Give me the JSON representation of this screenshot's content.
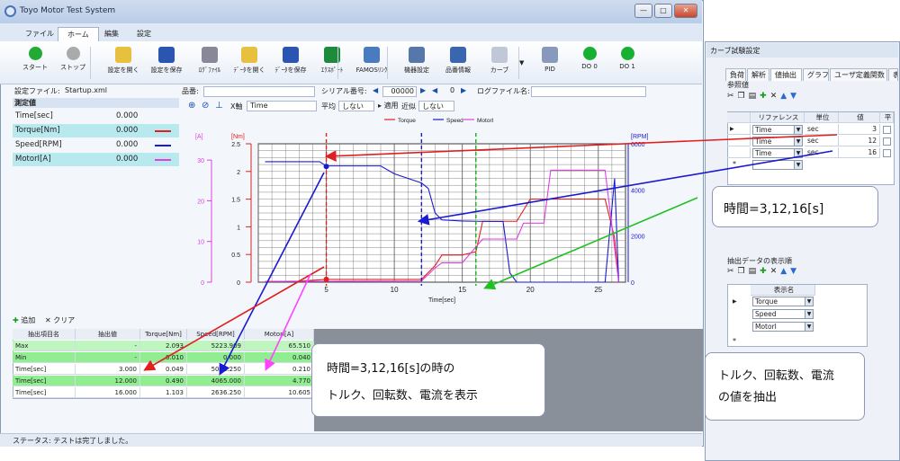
{
  "window": {
    "title": "Toyo Motor Test System",
    "controls": [
      "—",
      "□",
      "✕"
    ]
  },
  "menu": {
    "tabs": [
      "ファイル",
      "ホーム",
      "編集",
      "設定"
    ],
    "active": "ホーム"
  },
  "ribbon": {
    "buttons": [
      {
        "label": "スタート",
        "icon": "play-icon"
      },
      {
        "label": "ストップ",
        "icon": "stop-icon"
      },
      {
        "label": "設定を開く",
        "icon": "open-folder-icon"
      },
      {
        "label": "設定を保存",
        "icon": "save-icon"
      },
      {
        "label": "ﾛｸﾞﾌｧｲﾙ",
        "icon": "log-file-icon"
      },
      {
        "label": "ﾃﾞｰﾀを開く",
        "icon": "open-data-icon"
      },
      {
        "label": "ﾃﾞｰﾀを保存",
        "icon": "save-data-icon"
      },
      {
        "label": "ｴｸｽﾎﾟｰﾄ",
        "icon": "excel-icon"
      },
      {
        "label": "FAMOSﾘﾝｸ",
        "icon": "magnifier-icon"
      },
      {
        "label": "機器設定",
        "icon": "device-settings-icon"
      },
      {
        "label": "品番情報",
        "icon": "part-info-icon"
      },
      {
        "label": "カーブ",
        "icon": "curve-icon"
      },
      {
        "label": "PID",
        "icon": "pid-icon"
      },
      {
        "label": "DO 0",
        "icon": "green-led-icon"
      },
      {
        "label": "DO 1",
        "icon": "green-led-icon"
      }
    ]
  },
  "fields": {
    "settings_file_label": "設定ファイル:",
    "settings_file_value": "Startup.xml",
    "part_no_label": "品番:",
    "serial_label": "シリアル番号:",
    "serial_value": "00000",
    "serial_page": "0",
    "logfile_label": "ログファイル名:"
  },
  "measure": {
    "header": "測定値",
    "rows": [
      {
        "name": "Time[sec]",
        "value": "0.000",
        "color": ""
      },
      {
        "name": "Torque[Nm]",
        "value": "0.000",
        "color": "#e02020"
      },
      {
        "name": "Speed[RPM]",
        "value": "0.000",
        "color": "#1a1ad0"
      },
      {
        "name": "MotorI[A]",
        "value": "0.000",
        "color": "#e040e0"
      }
    ]
  },
  "chart_toolbar": {
    "xaxis_label": "X軸",
    "xaxis_value": "Time",
    "avg_label": "平均",
    "avg_value": "しない",
    "apply_label": "適用",
    "approx_label": "近似",
    "approx_value": "しない"
  },
  "chart_data": {
    "type": "line",
    "xlabel": "Time[sec]",
    "xlim": [
      0,
      27
    ],
    "x_ticks": [
      5,
      10,
      15,
      20,
      25
    ],
    "axes": [
      {
        "label": "[A]",
        "ticks": [
          "0",
          "10",
          "20",
          "30"
        ],
        "color": "#e040e0"
      },
      {
        "label": "[Nm]",
        "ticks": [
          "0",
          "0.5",
          "1",
          "1.5",
          "2",
          "2.5"
        ],
        "color": "#e02020"
      },
      {
        "label": "[RPM]",
        "ticks": [
          "0",
          "2000",
          "4000",
          "6000"
        ],
        "color": "#1a1ad0"
      }
    ],
    "legend": [
      "Torque",
      "Speed",
      "MotorI"
    ],
    "series": [
      {
        "name": "Torque",
        "color": "#e02020",
        "x": [
          0.5,
          3,
          5,
          9,
          12,
          13,
          13.5,
          15,
          16,
          16.5,
          19,
          20,
          21,
          25.5,
          26.2,
          26.5
        ],
        "y": [
          0.01,
          0.02,
          0.05,
          0.05,
          0.05,
          0.3,
          0.49,
          0.49,
          0.55,
          1.1,
          1.1,
          1.5,
          1.5,
          1.5,
          0.8,
          0.0
        ]
      },
      {
        "name": "Speed",
        "color": "#1a1ad0",
        "x": [
          0.5,
          4.5,
          5,
          9,
          10,
          12,
          12.5,
          13,
          13.5,
          15,
          16,
          18,
          18.5,
          19,
          25.5,
          26.2,
          26.5
        ],
        "y": [
          5223,
          5223,
          5041,
          5041,
          4700,
          4300,
          4065,
          3000,
          2700,
          2650,
          2640,
          2630,
          400,
          0,
          0,
          4500,
          0
        ]
      },
      {
        "name": "MotorI",
        "color": "#e040e0",
        "x": [
          0.5,
          5,
          12,
          13,
          13.5,
          15,
          16.5,
          19,
          19.5,
          21,
          21.5,
          25.5,
          26.5
        ],
        "y": [
          0.2,
          0.21,
          0.3,
          3.5,
          4.77,
          4.77,
          10.6,
          10.6,
          14.5,
          14.5,
          27.5,
          27.5,
          0.0
        ]
      }
    ],
    "markers": [
      {
        "x": 5,
        "color": "#e02020"
      },
      {
        "x": 12,
        "color": "#1a1ad0"
      },
      {
        "x": 16,
        "color": "#10b010"
      }
    ]
  },
  "extract_bar": {
    "add": "追加",
    "clear": "クリア"
  },
  "extract_table": {
    "headers": [
      "抽出項目名",
      "抽出値",
      "Torque[Nm]",
      "Speed[RPM]",
      "MotorI[A]"
    ],
    "rows": [
      [
        "Max",
        "-",
        "2.093",
        "5223.909",
        "65.510"
      ],
      [
        "Min",
        "-",
        "0.010",
        "0.000",
        "0.040"
      ],
      [
        "Time[sec]",
        "3.000",
        "0.049",
        "5041.250",
        "0.210"
      ],
      [
        "Time[sec]",
        "12.000",
        "0.490",
        "4065.000",
        "4.770"
      ],
      [
        "Time[sec]",
        "16.000",
        "1.103",
        "2636.250",
        "10.605"
      ]
    ]
  },
  "status": {
    "text": "ステータス:  テストは完了しました。"
  },
  "callouts": {
    "main_line1": "時間=3,12,16[s]の時の",
    "main_line2": "トルク、回転数、電流を表示",
    "time": "時間=3,12,16[s]",
    "extract_line1": "トルク、回転数、電流",
    "extract_line2": "の値を抽出"
  },
  "side": {
    "title": "カーブ試験設定",
    "tabs": [
      "負荷",
      "解析",
      "値抽出",
      "グラフ",
      "ユーザ定義関数",
      "表"
    ],
    "active_tab": "値抽出",
    "ref_header": "参照値",
    "ref_table": {
      "headers": [
        "リファレンス",
        "単位",
        "値",
        "平"
      ],
      "rows": [
        {
          "ref": "Time",
          "unit": "sec",
          "value": "3"
        },
        {
          "ref": "Time",
          "unit": "sec",
          "value": "12"
        },
        {
          "ref": "Time",
          "unit": "sec",
          "value": "16"
        }
      ]
    },
    "order_header": "抽出データの表示順",
    "order_table": {
      "header": "表示名",
      "rows": [
        "Torque",
        "Speed",
        "MotorI"
      ]
    }
  }
}
